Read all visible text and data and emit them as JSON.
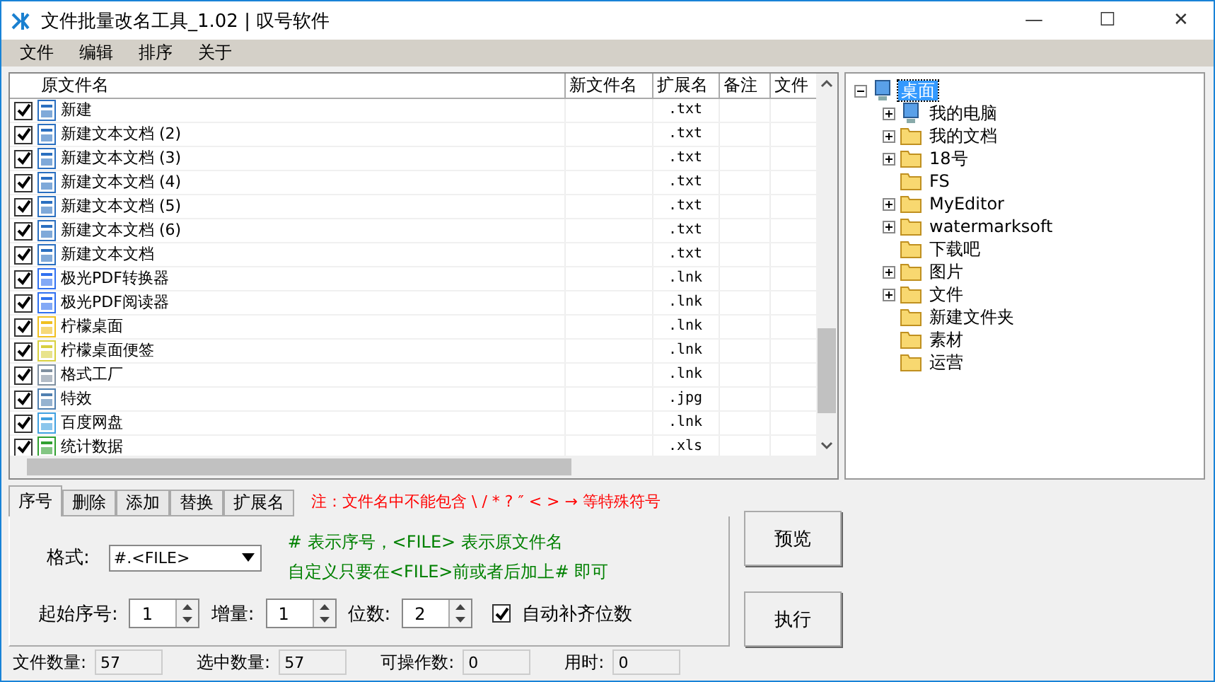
{
  "window": {
    "title": "文件批量改名工具_1.02 | 叹号软件",
    "controls": [
      "—",
      "☐",
      "✕"
    ]
  },
  "menu": [
    "文件",
    "编辑",
    "排序",
    "关于"
  ],
  "file_table": {
    "columns": [
      "原文件名",
      "新文件名",
      "扩展名",
      "备注",
      "文件"
    ],
    "rows": [
      {
        "checked": true,
        "kind": "text",
        "name": "新建",
        "ext": ".txt"
      },
      {
        "checked": true,
        "kind": "text",
        "name": "新建文本文档 (2)",
        "ext": ".txt"
      },
      {
        "checked": true,
        "kind": "text",
        "name": "新建文本文档 (3)",
        "ext": ".txt"
      },
      {
        "checked": true,
        "kind": "text",
        "name": "新建文本文档 (4)",
        "ext": ".txt"
      },
      {
        "checked": true,
        "kind": "text",
        "name": "新建文本文档 (5)",
        "ext": ".txt"
      },
      {
        "checked": true,
        "kind": "text",
        "name": "新建文本文档 (6)",
        "ext": ".txt"
      },
      {
        "checked": true,
        "kind": "text",
        "name": "新建文本文档",
        "ext": ".txt"
      },
      {
        "checked": true,
        "kind": "pdf",
        "name": "极光PDF转换器",
        "ext": ".lnk"
      },
      {
        "checked": true,
        "kind": "pdf",
        "name": "极光PDF阅读器",
        "ext": ".lnk"
      },
      {
        "checked": true,
        "kind": "lemon",
        "name": "柠檬桌面",
        "ext": ".lnk"
      },
      {
        "checked": true,
        "kind": "note",
        "name": "柠檬桌面便签",
        "ext": ".lnk"
      },
      {
        "checked": true,
        "kind": "app",
        "name": "格式工厂",
        "ext": ".lnk"
      },
      {
        "checked": true,
        "kind": "image",
        "name": "特效",
        "ext": ".jpg"
      },
      {
        "checked": true,
        "kind": "cloud",
        "name": "百度网盘",
        "ext": ".lnk"
      },
      {
        "checked": true,
        "kind": "sheet",
        "name": "统计数据",
        "ext": ".xls"
      }
    ]
  },
  "folder_tree": [
    {
      "label": "桌面",
      "kind": "computer",
      "selected": true,
      "expanded": true,
      "children": [
        {
          "label": "我的电脑",
          "kind": "computer",
          "selected": false,
          "expanded": false
        },
        {
          "label": "我的文档",
          "kind": "folder",
          "selected": false,
          "expanded": false
        },
        {
          "label": "18号",
          "kind": "folder",
          "selected": false,
          "expanded": false
        },
        {
          "label": "FS",
          "kind": "folder",
          "selected": false
        },
        {
          "label": "MyEditor",
          "kind": "folder",
          "selected": false,
          "expanded": false
        },
        {
          "label": "watermarksoft",
          "kind": "folder",
          "selected": false,
          "expanded": false
        },
        {
          "label": "下载吧",
          "kind": "folder",
          "selected": false
        },
        {
          "label": "图片",
          "kind": "folder",
          "selected": false,
          "expanded": false
        },
        {
          "label": "文件",
          "kind": "folder",
          "selected": false,
          "expanded": false
        },
        {
          "label": "新建文件夹",
          "kind": "folder",
          "selected": false
        },
        {
          "label": "素材",
          "kind": "folder",
          "selected": false
        },
        {
          "label": "运营",
          "kind": "folder",
          "selected": false
        }
      ]
    }
  ],
  "tabs": [
    {
      "label": "序号",
      "selected": true
    },
    {
      "label": "删除",
      "selected": false
    },
    {
      "label": "添加",
      "selected": false
    },
    {
      "label": "替换",
      "selected": false
    },
    {
      "label": "扩展名",
      "selected": false
    }
  ],
  "warning": "注：文件名中不能包含 \\ /  * ? ″ < > → 等特殊符号",
  "numbering": {
    "format_label": "格式:",
    "format_value": "#.<FILE>",
    "hint_1": "# 表示序号，<FILE> 表示原文件名",
    "hint_2": "自定义只要在<FILE>前或者后加上# 即可",
    "spinners": [
      {
        "label": "起始序号:",
        "value": "1"
      },
      {
        "label": "增量:",
        "value": "1"
      },
      {
        "label": "位数:",
        "value": "2"
      }
    ],
    "auto_pad": {
      "label": "自动补齐位数",
      "checked": true
    }
  },
  "buttons": [
    "预览",
    "执行"
  ],
  "status_bar": [
    {
      "label": "文件数量:",
      "value": "57"
    },
    {
      "label": "选中数量:",
      "value": "57"
    },
    {
      "label": "可操作数:",
      "value": "0"
    },
    {
      "label": "用时:",
      "value": "0"
    }
  ]
}
